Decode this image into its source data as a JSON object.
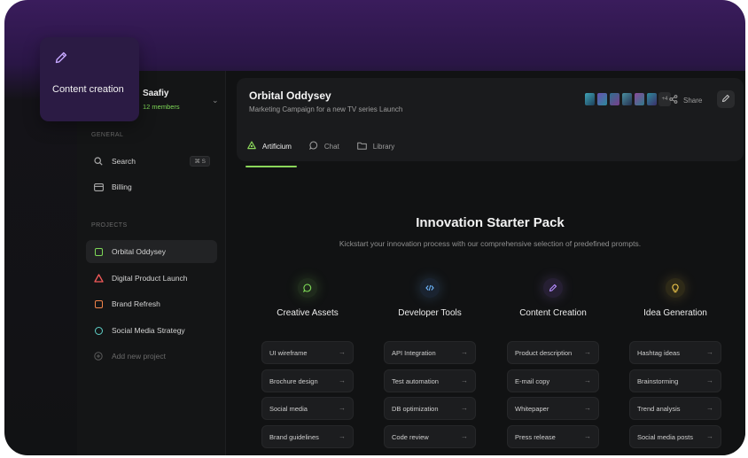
{
  "floating_card": {
    "label": "Content creation",
    "icon": "pencil-icon"
  },
  "workspace": {
    "name": "Saafiy",
    "members": "12 members"
  },
  "sidebar": {
    "general_label": "GENERAL",
    "search_label": "Search",
    "search_shortcut": "⌘ S",
    "billing_label": "Billing",
    "projects_label": "PROJECTS",
    "projects": [
      {
        "label": "Orbital Oddysey",
        "color": "#7ed957"
      },
      {
        "label": "Digital Product Launch",
        "color": "#f25a5a"
      },
      {
        "label": "Brand Refresh",
        "color": "#f2844a"
      },
      {
        "label": "Social Media Strategy",
        "color": "#5fd1c8"
      }
    ],
    "add_project_label": "Add new project"
  },
  "header": {
    "title": "Orbital Oddysey",
    "subtitle": "Marketing Campaign for a new TV series Launch",
    "avatar_more": "+4",
    "share_label": "Share",
    "tabs": [
      {
        "label": "Artificium",
        "icon": "artificium-icon"
      },
      {
        "label": "Chat",
        "icon": "chat-icon"
      },
      {
        "label": "Library",
        "icon": "folder-icon"
      }
    ]
  },
  "content": {
    "title": "Innovation Starter Pack",
    "subtitle": "Kickstart your innovation process with our comprehensive selection of predefined prompts.",
    "columns": [
      {
        "title": "Creative Assets",
        "icon": "chat-bubble-icon",
        "accent": "#7ed957",
        "prompts": [
          "UI wireframe",
          "Brochure design",
          "Social media",
          "Brand guidelines"
        ]
      },
      {
        "title": "Developer Tools",
        "icon": "code-icon",
        "accent": "#6fb8ff",
        "prompts": [
          "API Integration",
          "Test automation",
          "DB optimization",
          "Code review"
        ]
      },
      {
        "title": "Content Creation",
        "icon": "pencil-icon",
        "accent": "#b58cff",
        "prompts": [
          "Product description",
          "E-mail copy",
          "Whitepaper",
          "Press release"
        ]
      },
      {
        "title": "Idea Generation",
        "icon": "lightbulb-icon",
        "accent": "#f2c94c",
        "prompts": [
          "Hashtag ideas",
          "Brainstorming",
          "Trend analysis",
          "Social media posts"
        ]
      }
    ]
  }
}
